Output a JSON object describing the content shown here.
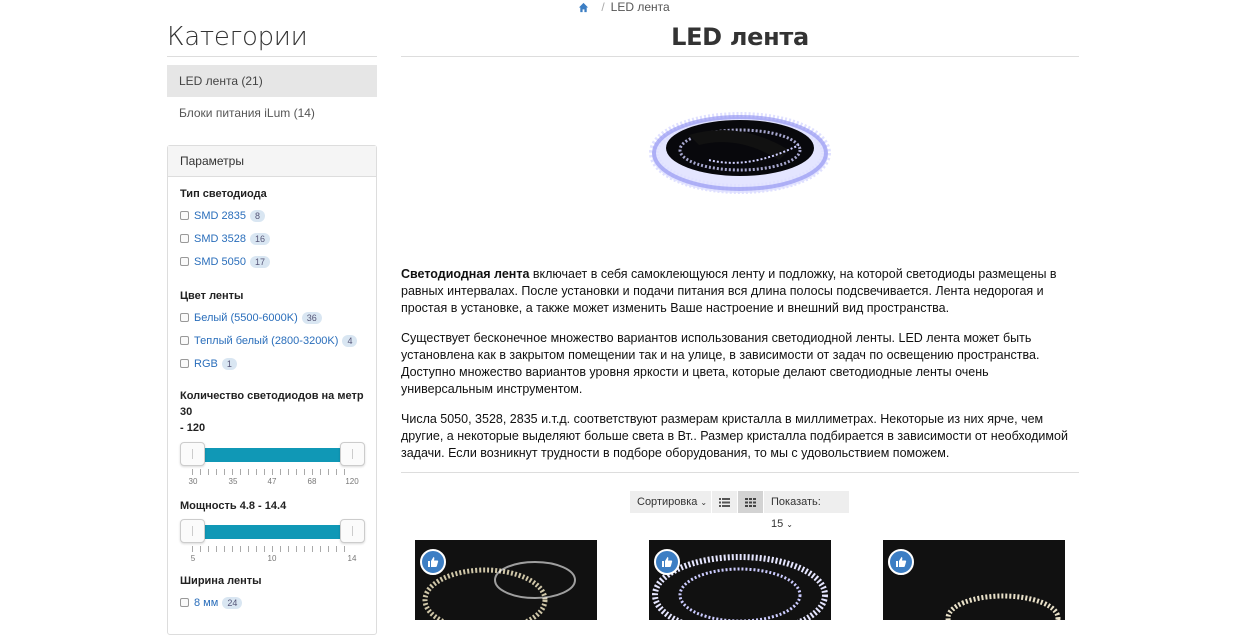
{
  "breadcrumb": {
    "current": "LED лента"
  },
  "sidebar": {
    "title": "Категории",
    "categories": [
      {
        "label": "LED лента (21)",
        "active": true
      },
      {
        "label": "Блоки питания iLum (14)",
        "active": false
      }
    ],
    "params_title": "Параметры",
    "led_type": {
      "title": "Тип светодиода",
      "options": [
        {
          "label": "SMD 2835",
          "count": "8"
        },
        {
          "label": "SMD 3528",
          "count": "16"
        },
        {
          "label": "SMD 5050",
          "count": "17"
        }
      ]
    },
    "color": {
      "title": "Цвет ленты",
      "options": [
        {
          "label": "Белый (5500-6000K)",
          "count": "36"
        },
        {
          "label": "Теплый белый (2800-3200K)",
          "count": "4"
        },
        {
          "label": "RGB",
          "count": "1"
        }
      ]
    },
    "density": {
      "title_line1": "Количество светодиодов на метр 30",
      "title_line2": "- 120",
      "min": 30,
      "max": 120,
      "labels": [
        "30",
        "35",
        "47",
        "68",
        "120"
      ]
    },
    "power": {
      "title": "Мощность 4.8 - 14.4",
      "min": 4.8,
      "max": 14.4,
      "labels": [
        "5",
        "10",
        "14"
      ]
    },
    "width": {
      "title": "Ширина ленты",
      "options": [
        {
          "label": "8 мм",
          "count": "24"
        }
      ]
    }
  },
  "main": {
    "title": "LED лента",
    "desc": {
      "p1_bold": "Светодиодная лента",
      "p1_rest": " включает в себя самоклеющуюся ленту и подложку, на которой светодиоды размещены в равных интервалах. После установки и подачи питания вся длина полосы подсвечивается. Лента недорогая и простая в установке, а также может изменить Ваше настроение и внешний вид пространства.",
      "p2": "Существует бесконечное множество вариантов использования светодиодной ленты. LED лента может быть установлена как в закрытом помещении так и на улице, в зависимости от задач по освещению пространства. Доступно множество вариантов уровня яркости и цвета, которые делают светодиодные ленты очень универсальным инструментом.",
      "p3": "Числа 5050, 3528, 2835 и.т.д. соответствуют размерам кристалла в миллиметрах. Некоторые из них ярче, чем другие, а некоторые выделяют больше света в Вт.. Размер кристалла подбирается в зависимости от необходимой задачи. Если возникнут трудности в подборе оборудования, то мы с удовольствием поможем."
    },
    "toolbar": {
      "sort_label": "Сортировка",
      "show_label": "Показать: 15"
    }
  },
  "colors": {
    "accent": "#1098b6",
    "link": "#2a6ebb",
    "badge": "#3c7ec4"
  }
}
